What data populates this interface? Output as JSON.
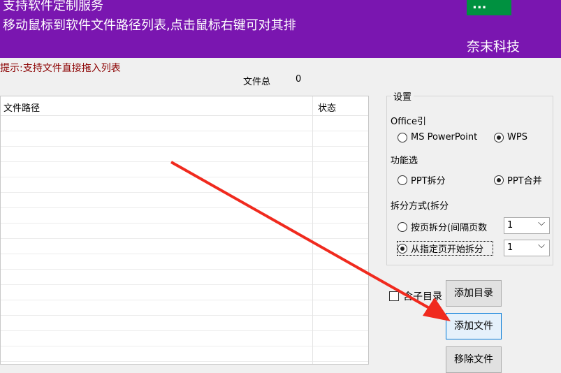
{
  "banner": {
    "line1": "支持软件定制服务",
    "line2": "移动鼠标到软件文件路径列表,点击鼠标右键可对其排",
    "company": "奈末科技",
    "logo_text": "..."
  },
  "hint": "提示:支持文件直接拖入列表",
  "file_total_label": "文件总",
  "file_total_value": "0",
  "table": {
    "columns": [
      "文件路径",
      "状态"
    ],
    "rows": []
  },
  "settings": {
    "title": "设置",
    "office_label": "Office引",
    "office_options": [
      "MS PowerPoint",
      "WPS"
    ],
    "office_selected": "WPS",
    "function_label": "功能选",
    "function_options": [
      "PPT拆分",
      "PPT合并"
    ],
    "function_selected": "PPT合并",
    "split_label": "拆分方式(拆分",
    "split_options": [
      "按页拆分(间隔页数",
      "从指定页开始拆分"
    ],
    "split_selected": "从指定页开始拆分",
    "split_values": [
      "1",
      "1"
    ]
  },
  "include_subdir": "含子目录",
  "buttons": {
    "add_dir": "添加目录",
    "add_file": "添加文件",
    "remove_file": "移除文件"
  },
  "colors": {
    "banner": "#7a16b0",
    "arrow": "#f02a1e"
  }
}
